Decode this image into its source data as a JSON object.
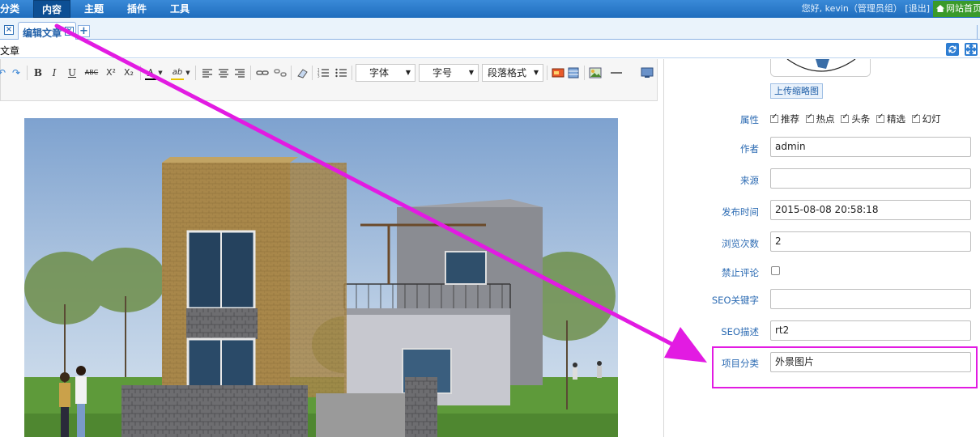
{
  "topnav": {
    "items": [
      "分类",
      "内容",
      "主题",
      "插件",
      "工具"
    ],
    "active_index": 1,
    "user_greeting": "您好, kevin（管理员组）",
    "logout": "[退出]",
    "home_link": "网站首页"
  },
  "tabs": {
    "items": [
      {
        "label": "编辑文章"
      }
    ],
    "add_label": "+",
    "close_glyph": "×"
  },
  "subheader": {
    "title": "文章"
  },
  "toolbar": {
    "bold": "B",
    "italic": "I",
    "underline": "U",
    "strike": "ABC",
    "superscript": "X²",
    "subscript": "X₂",
    "font_color": "A",
    "highlight": "ab",
    "font_family": "字体",
    "font_size": "字号",
    "paragraph_format": "段落格式"
  },
  "panel": {
    "upload_thumb_button": "上传缩略图",
    "attributes": {
      "label": "属性",
      "items": [
        {
          "label": "推荐",
          "checked": true
        },
        {
          "label": "热点",
          "checked": true
        },
        {
          "label": "头条",
          "checked": true
        },
        {
          "label": "精选",
          "checked": true
        },
        {
          "label": "幻灯",
          "checked": true
        }
      ]
    },
    "author": {
      "label": "作者",
      "value": "admin"
    },
    "source": {
      "label": "来源",
      "value": ""
    },
    "publish_time": {
      "label": "发布时间",
      "value": "2015-08-08 20:58:18"
    },
    "views": {
      "label": "浏览次数",
      "value": "2"
    },
    "disable_comment": {
      "label": "禁止评论",
      "checked": false
    },
    "seo_keywords": {
      "label": "SEO关键字",
      "value": ""
    },
    "seo_description": {
      "label": "SEO描述",
      "value": "rt2"
    },
    "project_category": {
      "label": "项目分类",
      "value": "外景图片"
    }
  },
  "colors": {
    "nav_blue": "#1f6dbd",
    "label_blue": "#2c6bb3",
    "annotation_magenta": "#e21be2",
    "home_green": "#3a9a2a"
  }
}
